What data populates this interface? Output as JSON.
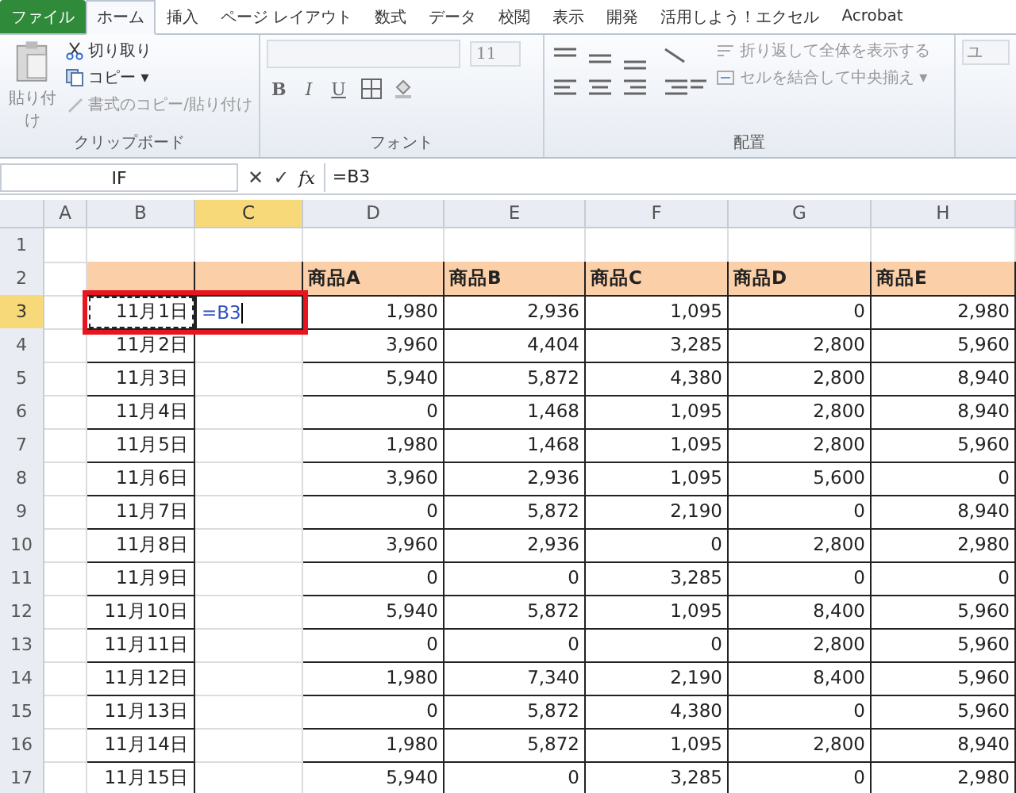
{
  "tabs": [
    {
      "label": "ファイル",
      "kind": "file",
      "selected": false
    },
    {
      "label": "ホーム",
      "kind": "tab",
      "selected": true
    },
    {
      "label": "挿入",
      "kind": "tab",
      "selected": false
    },
    {
      "label": "ページ レイアウト",
      "kind": "tab",
      "selected": false
    },
    {
      "label": "数式",
      "kind": "tab",
      "selected": false
    },
    {
      "label": "データ",
      "kind": "tab",
      "selected": false
    },
    {
      "label": "校閲",
      "kind": "tab",
      "selected": false
    },
    {
      "label": "表示",
      "kind": "tab",
      "selected": false
    },
    {
      "label": "開発",
      "kind": "tab",
      "selected": false
    },
    {
      "label": "活用しよう！エクセル",
      "kind": "tab",
      "selected": false
    },
    {
      "label": "Acrobat",
      "kind": "tab",
      "selected": false
    }
  ],
  "ribbon": {
    "clipboard": {
      "paste": "貼り付け",
      "cut": "切り取り",
      "copy": "コピー ▾",
      "format_painter": "書式のコピー/貼り付け",
      "label": "クリップボード"
    },
    "font": {
      "size": "11",
      "bold": "B",
      "italic": "I",
      "underline": "U",
      "label": "フォント"
    },
    "alignment": {
      "wrap": "折り返して全体を表示する",
      "merge": "セルを結合して中央揃え ▾",
      "label": "配置"
    },
    "next_group": "ユ"
  },
  "formula_bar": {
    "name_box": "IF",
    "cancel": "✕",
    "enter": "✓",
    "fx": "fx",
    "formula": "=B3"
  },
  "columns": [
    {
      "label": "A",
      "selected": false
    },
    {
      "label": "B",
      "selected": false
    },
    {
      "label": "C",
      "selected": true
    },
    {
      "label": "D",
      "selected": false
    },
    {
      "label": "E",
      "selected": false
    },
    {
      "label": "F",
      "selected": false
    },
    {
      "label": "G",
      "selected": false
    },
    {
      "label": "H",
      "selected": false
    }
  ],
  "rows": [
    {
      "number": "1",
      "kind": "blank",
      "selected": false
    },
    {
      "number": "2",
      "kind": "header",
      "selected": false,
      "labels": [
        "商品A",
        "商品B",
        "商品C",
        "商品D",
        "商品E"
      ]
    },
    {
      "number": "3",
      "kind": "data",
      "selected": true,
      "copied": true,
      "highlighted": true,
      "date": "11月1日",
      "input": "=B3",
      "values": [
        "1,980",
        "2,936",
        "1,095",
        "0",
        "2,980"
      ]
    },
    {
      "number": "4",
      "kind": "data",
      "selected": false,
      "copied": false,
      "highlighted": false,
      "date": "11月2日",
      "values": [
        "3,960",
        "4,404",
        "3,285",
        "2,800",
        "5,960"
      ]
    },
    {
      "number": "5",
      "kind": "data",
      "selected": false,
      "copied": false,
      "highlighted": false,
      "date": "11月3日",
      "values": [
        "5,940",
        "5,872",
        "4,380",
        "2,800",
        "8,940"
      ]
    },
    {
      "number": "6",
      "kind": "data",
      "selected": false,
      "copied": false,
      "highlighted": false,
      "date": "11月4日",
      "values": [
        "0",
        "1,468",
        "1,095",
        "2,800",
        "8,940"
      ]
    },
    {
      "number": "7",
      "kind": "data",
      "selected": false,
      "copied": false,
      "highlighted": false,
      "date": "11月5日",
      "values": [
        "1,980",
        "1,468",
        "1,095",
        "2,800",
        "5,960"
      ]
    },
    {
      "number": "8",
      "kind": "data",
      "selected": false,
      "copied": false,
      "highlighted": false,
      "date": "11月6日",
      "values": [
        "3,960",
        "2,936",
        "1,095",
        "5,600",
        "0"
      ]
    },
    {
      "number": "9",
      "kind": "data",
      "selected": false,
      "copied": false,
      "highlighted": false,
      "date": "11月7日",
      "values": [
        "0",
        "5,872",
        "2,190",
        "0",
        "8,940"
      ]
    },
    {
      "number": "10",
      "kind": "data",
      "selected": false,
      "copied": false,
      "highlighted": false,
      "date": "11月8日",
      "values": [
        "3,960",
        "2,936",
        "0",
        "2,800",
        "2,980"
      ]
    },
    {
      "number": "11",
      "kind": "data",
      "selected": false,
      "copied": false,
      "highlighted": false,
      "date": "11月9日",
      "values": [
        "0",
        "0",
        "3,285",
        "0",
        "0"
      ]
    },
    {
      "number": "12",
      "kind": "data",
      "selected": false,
      "copied": false,
      "highlighted": false,
      "date": "11月10日",
      "values": [
        "5,940",
        "5,872",
        "1,095",
        "8,400",
        "5,960"
      ]
    },
    {
      "number": "13",
      "kind": "data",
      "selected": false,
      "copied": false,
      "highlighted": false,
      "date": "11月11日",
      "values": [
        "0",
        "0",
        "0",
        "2,800",
        "5,960"
      ]
    },
    {
      "number": "14",
      "kind": "data",
      "selected": false,
      "copied": false,
      "highlighted": false,
      "date": "11月12日",
      "values": [
        "1,980",
        "7,340",
        "2,190",
        "8,400",
        "5,960"
      ]
    },
    {
      "number": "15",
      "kind": "data",
      "selected": false,
      "copied": false,
      "highlighted": false,
      "date": "11月13日",
      "values": [
        "0",
        "5,872",
        "4,380",
        "0",
        "5,960"
      ]
    },
    {
      "number": "16",
      "kind": "data",
      "selected": false,
      "copied": false,
      "highlighted": false,
      "date": "11月14日",
      "values": [
        "1,980",
        "5,872",
        "1,095",
        "2,800",
        "8,940"
      ]
    },
    {
      "number": "17",
      "kind": "data",
      "selected": false,
      "copied": false,
      "highlighted": false,
      "date": "11月15日",
      "values": [
        "5,940",
        "0",
        "3,285",
        "0",
        "2,980"
      ]
    }
  ]
}
